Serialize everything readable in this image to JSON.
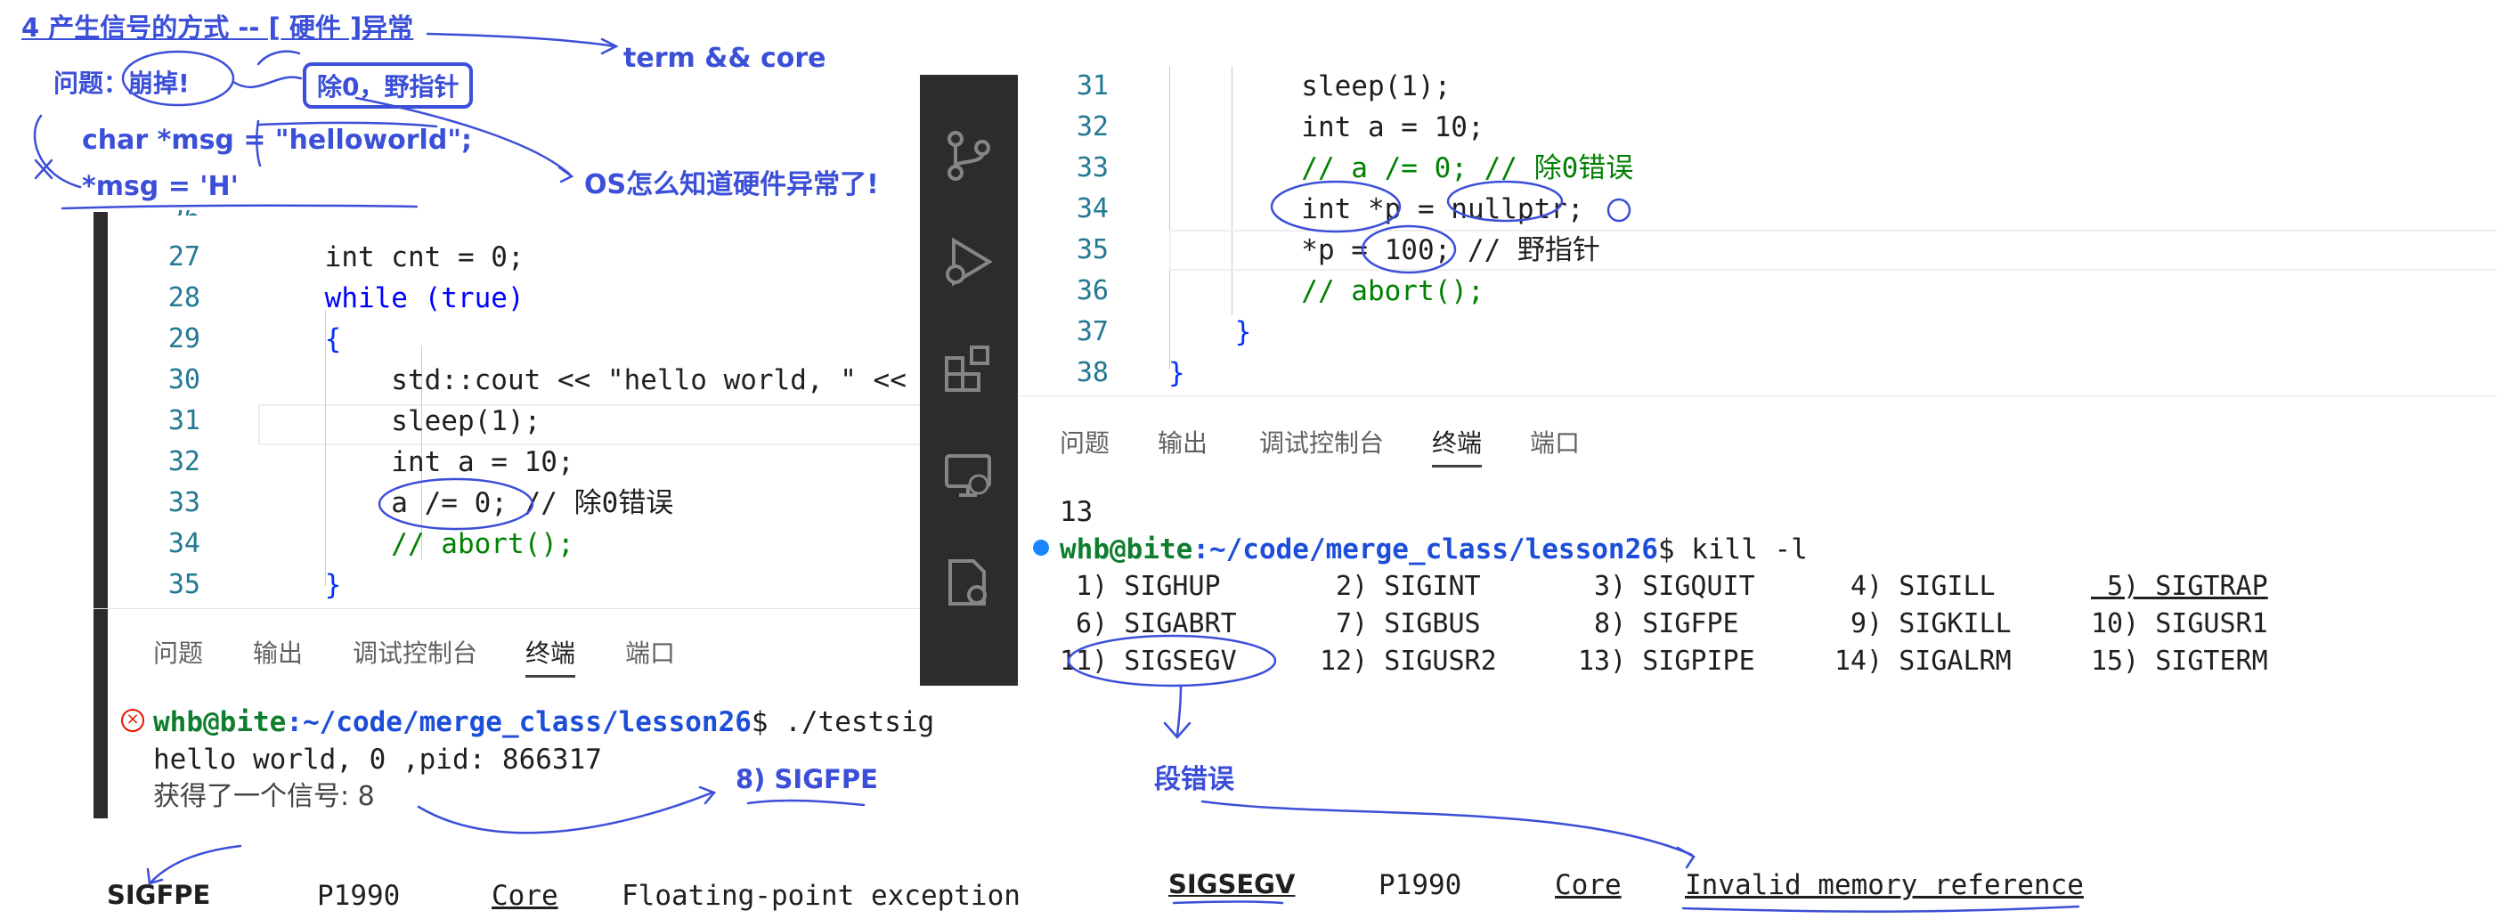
{
  "annotations": {
    "heading": "4 产生信号的方式 -- [ 硬件 ]异常",
    "term_core": "term && core",
    "problem_label": "问题：崩掉!",
    "box_label": "除0，野指针",
    "os_question": "OS怎么知道硬件异常了!",
    "char_msg": "char *msg = \"helloworld\";",
    "msg_assign": "*msg = 'H'",
    "sigfpe_note": "8) SIGFPE",
    "segfault_note": "段错误"
  },
  "left_editor": {
    "lines": [
      {
        "n": "26",
        "code": "    // }"
      },
      {
        "n": "27",
        "code": "    int cnt = 0;"
      },
      {
        "n": "28",
        "code": "    while (true)"
      },
      {
        "n": "29",
        "code": "    {"
      },
      {
        "n": "30",
        "code": "        std::cout << \"hello world, \" <<"
      },
      {
        "n": "31",
        "code": "        sleep(1);"
      },
      {
        "n": "32",
        "code": "        int a = 10;"
      },
      {
        "n": "33",
        "code": "        a /= 0; // 除0错误"
      },
      {
        "n": "34",
        "code": "        // abort();"
      },
      {
        "n": "35",
        "code": "    }"
      }
    ]
  },
  "left_panel": {
    "tabs": [
      "问题",
      "输出",
      "调试控制台",
      "终端",
      "端口"
    ],
    "active_tab": "终端",
    "prompt_user": "whb@bite",
    "prompt_path": ":~/code/merge_class/lesson26",
    "prompt_cmd": "$ ./testsig",
    "output1": "hello world, 0 ,pid: 866317",
    "output2": "获得了一个信号: 8"
  },
  "right_editor": {
    "lines": [
      {
        "n": "31",
        "code": "        sleep(1);"
      },
      {
        "n": "32",
        "code": "        int a = 10;"
      },
      {
        "n": "33",
        "code": "        // a /= 0; // 除0错误"
      },
      {
        "n": "34",
        "code": "        int *p = nullptr;"
      },
      {
        "n": "35",
        "code": "        *p = 100; // 野指针"
      },
      {
        "n": "36",
        "code": "        // abort();"
      },
      {
        "n": "37",
        "code": "    }"
      },
      {
        "n": "38",
        "code": "}"
      }
    ]
  },
  "right_panel": {
    "tabs": [
      "问题",
      "输出",
      "调试控制台",
      "终端",
      "端口"
    ],
    "active_tab": "终端",
    "line13": "13",
    "prompt_user": "whb@bite",
    "prompt_path": ":~/code/merge_class/lesson26",
    "prompt_cmd": "$ kill -l",
    "signals_row1": [
      " 1) SIGHUP",
      " 2) SIGINT",
      " 3) SIGQUIT",
      " 4) SIGILL",
      " 5) SIGTRAP"
    ],
    "signals_row2": [
      " 6) SIGABRT",
      " 7) SIGBUS",
      " 8) SIGFPE",
      " 9) SIGKILL",
      "10) SIGUSR1"
    ],
    "signals_row3": [
      "11) SIGSEGV",
      "12) SIGUSR2",
      "13) SIGPIPE",
      "14) SIGALRM",
      "15) SIGTERM"
    ]
  },
  "man_left": {
    "name": "SIGFPE",
    "std": "P1990",
    "action": "Core",
    "desc": "Floating-point exception"
  },
  "man_right": {
    "name": "SIGSEGV",
    "std": "P1990",
    "action": "Core",
    "desc": "Invalid memory reference"
  },
  "activity_icons": [
    "source-control-icon",
    "run-debug-icon",
    "extensions-icon",
    "remote-explorer-icon",
    "settings-file-icon"
  ]
}
